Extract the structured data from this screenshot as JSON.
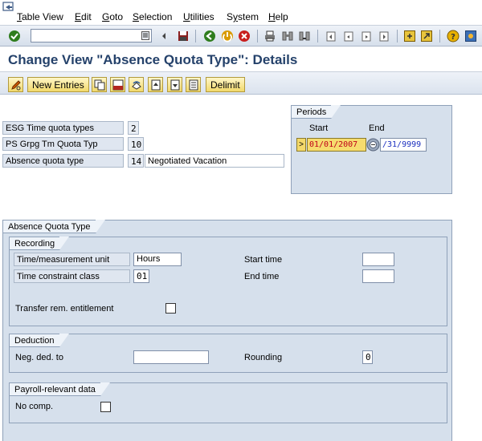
{
  "menu": {
    "items": [
      {
        "label": "Table View",
        "u": "T"
      },
      {
        "label": "Edit",
        "u": "E"
      },
      {
        "label": "Goto",
        "u": "G"
      },
      {
        "label": "Selection",
        "u": "S"
      },
      {
        "label": "Utilities",
        "u": "U"
      },
      {
        "label": "System",
        "u": "y"
      },
      {
        "label": "Help",
        "u": "H"
      }
    ]
  },
  "toolbar": {
    "command_field_value": ""
  },
  "title": "Change View \"Absence Quota Type\": Details",
  "app_toolbar": {
    "new_entries": "New Entries",
    "delimit": "Delimit"
  },
  "keys": {
    "esg_label": "ESG Time quota types",
    "esg_value": "2",
    "psgrp_label": "PS Grpg Tm Quota Typ",
    "psgrp_value": "10",
    "abs_label": "Absence quota type",
    "abs_value": "14",
    "abs_text": "Negotiated Vacation"
  },
  "periods": {
    "title": "Periods",
    "start_label": "Start",
    "end_label": "End",
    "marker": ">",
    "start_date": "01/01/2007",
    "end_date": "/31/9999"
  },
  "absence_quota_type": {
    "title": "Absence Quota Type",
    "recording": {
      "title": "Recording",
      "time_unit_label": "Time/measurement unit",
      "time_unit_value": "Hours",
      "constraint_label": "Time constraint class",
      "constraint_value": "01",
      "start_time_label": "Start time",
      "end_time_label": "End time",
      "transfer_label": "Transfer rem. entitlement"
    },
    "deduction": {
      "title": "Deduction",
      "neg_label": "Neg. ded. to",
      "rounding_label": "Rounding",
      "rounding_value": "0"
    },
    "payroll": {
      "title": "Payroll-relevant data",
      "nocomp_label": "No comp."
    }
  },
  "colors": {
    "title": "#25426b",
    "group_bg": "#d6e0ec",
    "date_start": "#c0001a",
    "date_end": "#1b2fbf"
  }
}
